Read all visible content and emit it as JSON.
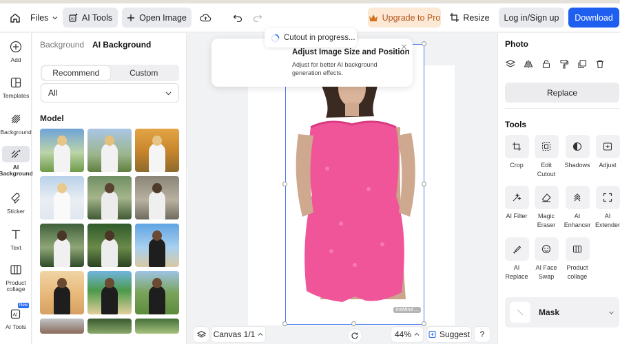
{
  "topbar": {
    "files_label": "Files",
    "ai_tools_label": "AI Tools",
    "open_image_label": "Open Image",
    "upgrade_label": "Upgrade to Pro",
    "resize_label": "Resize",
    "login_label": "Log in/Sign up",
    "download_label": "Download"
  },
  "leftnav": {
    "items": [
      {
        "label": "Add",
        "icon": "plus-circle-icon"
      },
      {
        "label": "Templates",
        "icon": "templates-icon"
      },
      {
        "label": "Background",
        "icon": "background-hatch-icon"
      },
      {
        "label": "AI Background",
        "icon": "ai-background-icon",
        "active": true
      },
      {
        "label": "Sticker",
        "icon": "sticker-icon"
      },
      {
        "label": "Text",
        "icon": "text-icon"
      },
      {
        "label": "Product collage",
        "icon": "collage-icon"
      },
      {
        "label": "AI Tools",
        "icon": "ai-tools-icon",
        "badge": "New"
      }
    ]
  },
  "panel": {
    "breadcrumb_parent": "Background",
    "breadcrumb_current": "AI Background",
    "tabs": [
      "Recommend",
      "Custom"
    ],
    "filter_value": "All",
    "section_title": "Model"
  },
  "canvas": {
    "progress_text": "Cutout in progress...",
    "tip_title": "Adjust Image Size and Position",
    "tip_desc": "Adjust for better AI background generation effects.",
    "watermark": "InsMind ...",
    "canvas_label": "Canvas 1/1",
    "zoom": "44%",
    "suggest_label": "Suggest",
    "help_label": "?"
  },
  "rightpanel": {
    "photo_title": "Photo",
    "replace_label": "Replace",
    "tools_title": "Tools",
    "tools": [
      {
        "label": "Crop",
        "icon": "crop-icon"
      },
      {
        "label": "Edit Cutout",
        "icon": "edit-cutout-icon"
      },
      {
        "label": "Shadows",
        "icon": "shadows-icon"
      },
      {
        "label": "Adjust",
        "icon": "adjust-icon"
      },
      {
        "label": "AI Filter",
        "icon": "ai-filter-icon"
      },
      {
        "label": "Magic Eraser",
        "icon": "eraser-icon"
      },
      {
        "label": "AI Enhancer",
        "icon": "enhancer-icon"
      },
      {
        "label": "AI Extender",
        "icon": "extender-icon"
      },
      {
        "label": "AI Replace",
        "icon": "ai-replace-icon"
      },
      {
        "label": "AI Face Swap",
        "icon": "face-swap-icon"
      },
      {
        "label": "Product collage",
        "icon": "collage-icon"
      }
    ],
    "mask_label": "Mask"
  },
  "colors": {
    "accent_blue": "#1f5ff0",
    "upgrade_bg": "#fbe9d6",
    "upgrade_text": "#b4561b",
    "dress_pink": "#f0559a"
  }
}
